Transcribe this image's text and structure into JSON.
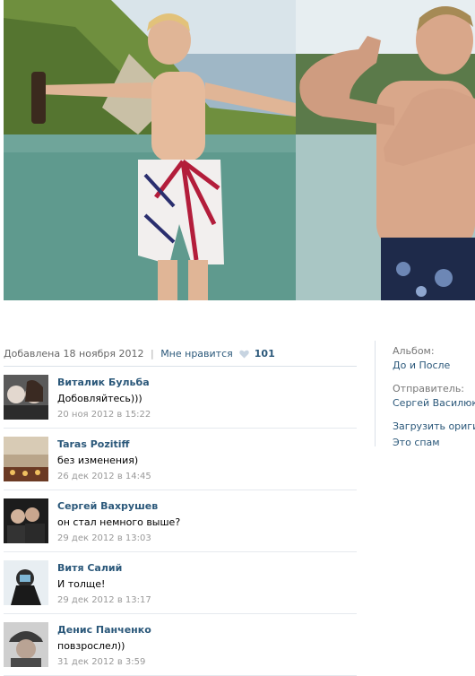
{
  "photo": {
    "alt_left": "photo-left",
    "alt_right": "photo-right"
  },
  "meta": {
    "added": "Добавлена 18 ноября 2012",
    "separator": "|",
    "like_label": "Мне нравится",
    "heart_icon": "heart-icon",
    "likes_count": "101"
  },
  "sidebar": {
    "album_label": "Альбом:",
    "album_name": "До и После",
    "sender_label": "Отправитель:",
    "sender_name": "Сергей Василюк",
    "download_original": "Загрузить оригинал",
    "spam": "Это спам"
  },
  "comments": [
    {
      "author": "Виталик Бульба",
      "text": "Добовляйтесь)))",
      "date": "20 ноя 2012 в 15:22"
    },
    {
      "author": "Taras Pozitiff",
      "text": "без изменения)",
      "date": "26 дек 2012 в 14:45"
    },
    {
      "author": "Сергей Вахрушев",
      "text": "он стал немного выше?",
      "date": "29 дек 2012 в 13:03"
    },
    {
      "author": "Витя Салий",
      "text": "И толще!",
      "date": "29 дек 2012 в 13:17"
    },
    {
      "author": "Денис Панченко",
      "text": "повзрослел))",
      "date": "31 дек 2012 в 3:59"
    }
  ],
  "colors": {
    "link": "#2b587a",
    "muted": "#999999"
  }
}
